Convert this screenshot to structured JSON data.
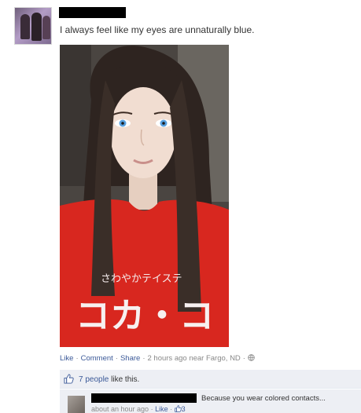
{
  "post": {
    "status_text": "I always feel like my eyes are unnaturally blue.",
    "actions": {
      "like": "Like",
      "comment": "Comment",
      "share": "Share",
      "separator": "·",
      "time_location": "2 hours ago near Fargo, ND",
      "privacy_icon": "globe-icon"
    },
    "likes": {
      "icon": "thumbs-up-icon",
      "people_link": "7 people",
      "suffix": " like this."
    },
    "comment": {
      "text": "Because you wear colored contacts...",
      "time": "about an hour ago",
      "separator": " · ",
      "like_label": "Like",
      "like_count": "3",
      "like_icon": "thumbs-up-icon"
    },
    "photo": {
      "shirt_text_katakana": "さわやかテイステ",
      "shirt_text_large": "コカ・コ"
    }
  },
  "colors": {
    "link": "#3b5998",
    "meta_text": "#888888",
    "ufi_background": "#edeff4",
    "shirt_red": "#d8271f"
  }
}
